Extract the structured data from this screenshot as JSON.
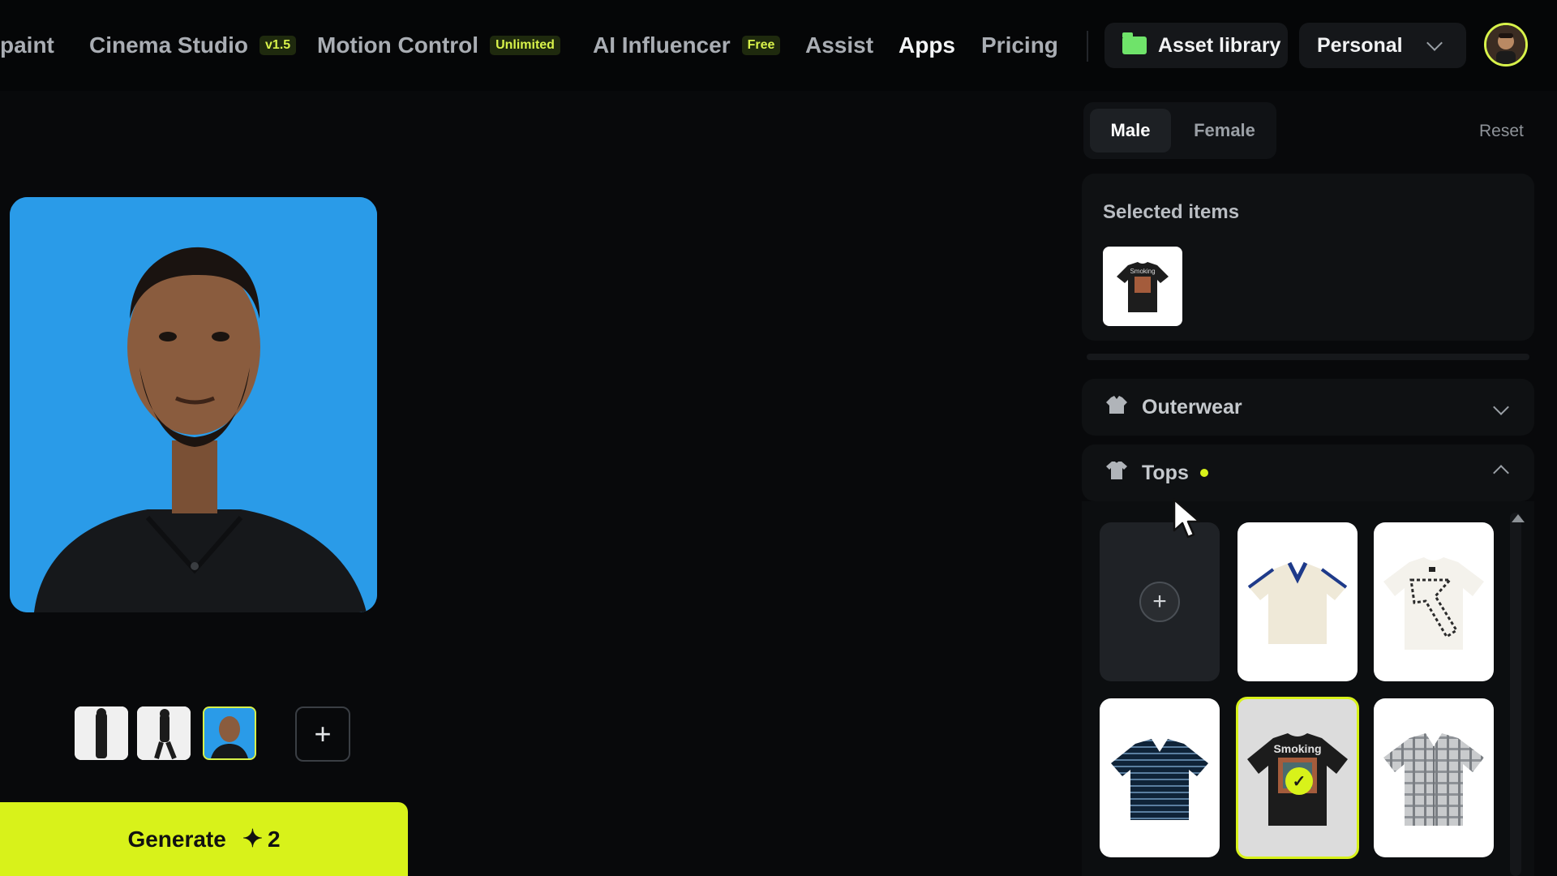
{
  "nav": {
    "items": [
      {
        "label": "paint",
        "badge": null,
        "active": false
      },
      {
        "label": "Cinema Studio",
        "badge": "v1.5",
        "active": false
      },
      {
        "label": "Motion Control",
        "badge": "Unlimited",
        "active": false
      },
      {
        "label": "AI Influencer",
        "badge": "Free",
        "active": false
      },
      {
        "label": "Assist",
        "badge": null,
        "active": false
      },
      {
        "label": "Apps",
        "badge": null,
        "active": true
      },
      {
        "label": "Pricing",
        "badge": null,
        "active": false
      }
    ],
    "asset_library": "Asset library",
    "workspace": "Personal"
  },
  "editor": {
    "generate_label": "Generate",
    "generate_cost": "2",
    "thumb_add": "+"
  },
  "panel": {
    "gender_tabs": [
      "Male",
      "Female"
    ],
    "gender_selected": "Male",
    "reset_label": "Reset",
    "selected_title": "Selected items",
    "sections": [
      {
        "label": "Outerwear",
        "icon": "jacket-icon",
        "expanded": false
      },
      {
        "label": "Tops",
        "icon": "tshirt-icon",
        "expanded": true,
        "has_selection": true
      }
    ],
    "tops_tiles": [
      {
        "type": "add",
        "label": "+"
      },
      {
        "type": "item",
        "name": "cream-polo-shirt"
      },
      {
        "type": "item",
        "name": "white-graphic-tee"
      },
      {
        "type": "item",
        "name": "navy-striped-polo"
      },
      {
        "type": "item",
        "name": "black-graphic-tee",
        "selected": true,
        "print_text": "Smoking"
      },
      {
        "type": "item",
        "name": "plaid-short-sleeve-shirt"
      }
    ],
    "selected_item_text": "Smoking"
  },
  "colors": {
    "accent": "#d8f21a",
    "background": "#08090b",
    "portrait_bg": "#2a9be8"
  }
}
